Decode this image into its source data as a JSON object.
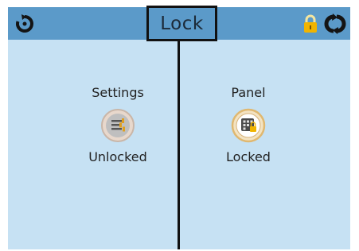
{
  "header": {
    "title": "Lock",
    "back_icon": "rotate-back-icon",
    "lock_icon": "padlock-icon",
    "refresh_icon": "refresh-icon",
    "bar_color": "#5b9ac9"
  },
  "tiles": [
    {
      "name": "Settings",
      "status": "Unlocked",
      "icon": "settings-sliders-icon"
    },
    {
      "name": "Panel",
      "status": "Locked",
      "icon": "panel-keypad-icon"
    }
  ],
  "colors": {
    "background": "#c6e1f3",
    "accent": "#f0b400"
  }
}
